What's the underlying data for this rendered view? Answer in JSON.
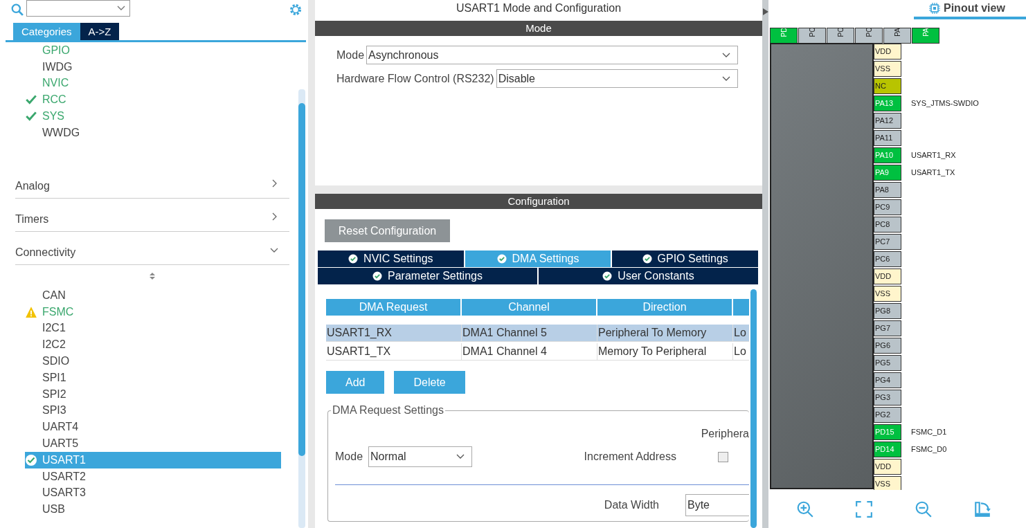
{
  "left_panel": {
    "tabs": [
      {
        "label": "Categories",
        "selected": true
      },
      {
        "label": "A->Z",
        "selected": false
      }
    ],
    "system_items": [
      {
        "label": "GPIO",
        "configured": true,
        "ok": false,
        "warning": false,
        "selected": false
      },
      {
        "label": "IWDG",
        "configured": false,
        "ok": false,
        "warning": false,
        "selected": false
      },
      {
        "label": "NVIC",
        "configured": true,
        "ok": false,
        "warning": false,
        "selected": false
      },
      {
        "label": "RCC",
        "configured": true,
        "ok": true,
        "warning": false,
        "selected": false
      },
      {
        "label": "SYS",
        "configured": true,
        "ok": true,
        "warning": false,
        "selected": false
      },
      {
        "label": "WWDG",
        "configured": false,
        "ok": false,
        "warning": false,
        "selected": false
      }
    ],
    "categories": [
      {
        "label": "Analog",
        "expanded": false
      },
      {
        "label": "Timers",
        "expanded": false
      },
      {
        "label": "Connectivity",
        "expanded": true
      }
    ],
    "connectivity_items": [
      {
        "label": "CAN",
        "configured": false,
        "ok": false,
        "warning": false,
        "selected": false
      },
      {
        "label": "FSMC",
        "configured": true,
        "ok": false,
        "warning": true,
        "selected": false
      },
      {
        "label": "I2C1",
        "configured": false,
        "ok": false,
        "warning": false,
        "selected": false
      },
      {
        "label": "I2C2",
        "configured": false,
        "ok": false,
        "warning": false,
        "selected": false
      },
      {
        "label": "SDIO",
        "configured": false,
        "ok": false,
        "warning": false,
        "selected": false
      },
      {
        "label": "SPI1",
        "configured": false,
        "ok": false,
        "warning": false,
        "selected": false
      },
      {
        "label": "SPI2",
        "configured": false,
        "ok": false,
        "warning": false,
        "selected": false
      },
      {
        "label": "SPI3",
        "configured": false,
        "ok": false,
        "warning": false,
        "selected": false
      },
      {
        "label": "UART4",
        "configured": false,
        "ok": false,
        "warning": false,
        "selected": false
      },
      {
        "label": "UART5",
        "configured": false,
        "ok": false,
        "warning": false,
        "selected": false
      },
      {
        "label": "USART1",
        "configured": true,
        "ok": true,
        "warning": false,
        "selected": true
      },
      {
        "label": "USART2",
        "configured": false,
        "ok": false,
        "warning": false,
        "selected": false
      },
      {
        "label": "USART3",
        "configured": false,
        "ok": false,
        "warning": false,
        "selected": false
      },
      {
        "label": "USB",
        "configured": false,
        "ok": false,
        "warning": false,
        "selected": false
      }
    ]
  },
  "config_panel": {
    "title": "USART1 Mode and Configuration",
    "mode_header": "Mode",
    "mode_fields": [
      {
        "label": "Mode",
        "value": "Asynchronous"
      },
      {
        "label": "Hardware Flow Control (RS232)",
        "value": "Disable"
      }
    ],
    "config_header": "Configuration",
    "reset_button": "Reset Configuration",
    "tab_rows": [
      [
        {
          "label": "NVIC Settings",
          "selected": false
        },
        {
          "label": "DMA Settings",
          "selected": true
        },
        {
          "label": "GPIO Settings",
          "selected": false
        }
      ],
      [
        {
          "label": "Parameter Settings",
          "selected": false
        },
        {
          "label": "User Constants",
          "selected": false
        }
      ]
    ],
    "table": {
      "columns": [
        "DMA Request",
        "Channel",
        "Direction"
      ],
      "rows": [
        {
          "cells": [
            "USART1_RX",
            "DMA1 Channel 5",
            "Peripheral To Memory",
            "Lo"
          ],
          "selected": true
        },
        {
          "cells": [
            "USART1_TX",
            "DMA1 Channel 4",
            "Memory To Peripheral",
            "Lo"
          ],
          "selected": false
        }
      ]
    },
    "buttons": [
      "Add",
      "Delete"
    ],
    "request_settings": {
      "title": "DMA Request Settings",
      "column_label": "Periphera",
      "mode_label": "Mode",
      "mode_value": "Normal",
      "increment_label": "Increment Address",
      "increment_checked": false,
      "width_label": "Data Width",
      "width_value": "Byte"
    }
  },
  "pinout": {
    "tab": {
      "label": "Pinout view"
    },
    "top_pins": [
      {
        "label": "PD",
        "kind": "assigned"
      },
      {
        "label": "PC",
        "kind": "gpio"
      },
      {
        "label": "PC",
        "kind": "gpio"
      },
      {
        "label": "PC",
        "kind": "gpio"
      },
      {
        "label": "PA",
        "kind": "gpio"
      },
      {
        "label": "PA",
        "kind": "assigned"
      }
    ],
    "right_pins": [
      {
        "label": "VDD",
        "kind": "power"
      },
      {
        "label": "VSS",
        "kind": "power"
      },
      {
        "label": "NC",
        "kind": "nc"
      },
      {
        "label": "PA13",
        "kind": "assigned",
        "signal": "SYS_JTMS-SWDIO"
      },
      {
        "label": "PA12",
        "kind": "gpio"
      },
      {
        "label": "PA11",
        "kind": "gpio"
      },
      {
        "label": "PA10",
        "kind": "assigned",
        "signal": "USART1_RX"
      },
      {
        "label": "PA9",
        "kind": "assigned",
        "signal": "USART1_TX"
      },
      {
        "label": "PA8",
        "kind": "gpio"
      },
      {
        "label": "PC9",
        "kind": "gpio"
      },
      {
        "label": "PC8",
        "kind": "gpio"
      },
      {
        "label": "PC7",
        "kind": "gpio"
      },
      {
        "label": "PC6",
        "kind": "gpio"
      },
      {
        "label": "VDD",
        "kind": "power"
      },
      {
        "label": "VSS",
        "kind": "power"
      },
      {
        "label": "PG8",
        "kind": "gpio"
      },
      {
        "label": "PG7",
        "kind": "gpio"
      },
      {
        "label": "PG6",
        "kind": "gpio"
      },
      {
        "label": "PG5",
        "kind": "gpio"
      },
      {
        "label": "PG4",
        "kind": "gpio"
      },
      {
        "label": "PG3",
        "kind": "gpio"
      },
      {
        "label": "PG2",
        "kind": "gpio"
      },
      {
        "label": "PD15",
        "kind": "assigned",
        "signal": "FSMC_D1"
      },
      {
        "label": "PD14",
        "kind": "assigned",
        "signal": "FSMC_D0"
      },
      {
        "label": "VDD",
        "kind": "power"
      },
      {
        "label": "VSS",
        "kind": "power"
      }
    ]
  }
}
